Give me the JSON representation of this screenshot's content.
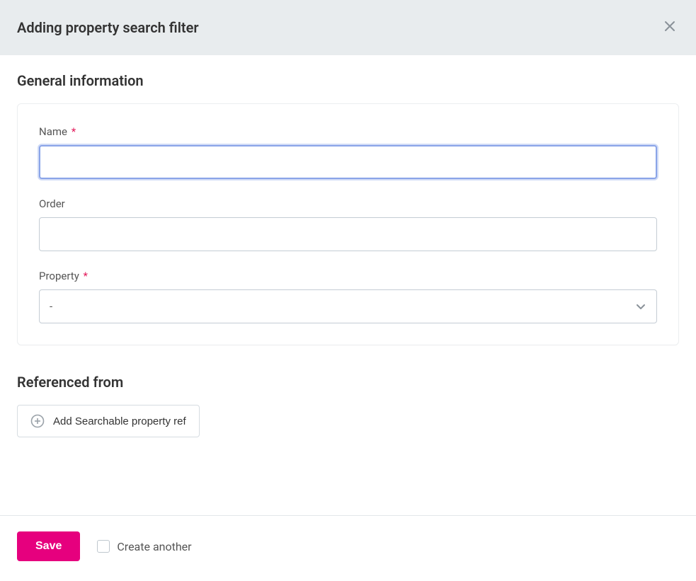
{
  "header": {
    "title": "Adding property search filter"
  },
  "sections": {
    "general": {
      "title": "General information",
      "fields": {
        "name": {
          "label": "Name",
          "required_mark": "*",
          "value": ""
        },
        "order": {
          "label": "Order",
          "value": ""
        },
        "property": {
          "label": "Property",
          "required_mark": "*",
          "selected": "-"
        }
      }
    },
    "referenced": {
      "title": "Referenced from",
      "add_button_label": "Add Searchable property ref"
    }
  },
  "footer": {
    "save_label": "Save",
    "create_another_label": "Create another",
    "create_another_checked": false
  }
}
